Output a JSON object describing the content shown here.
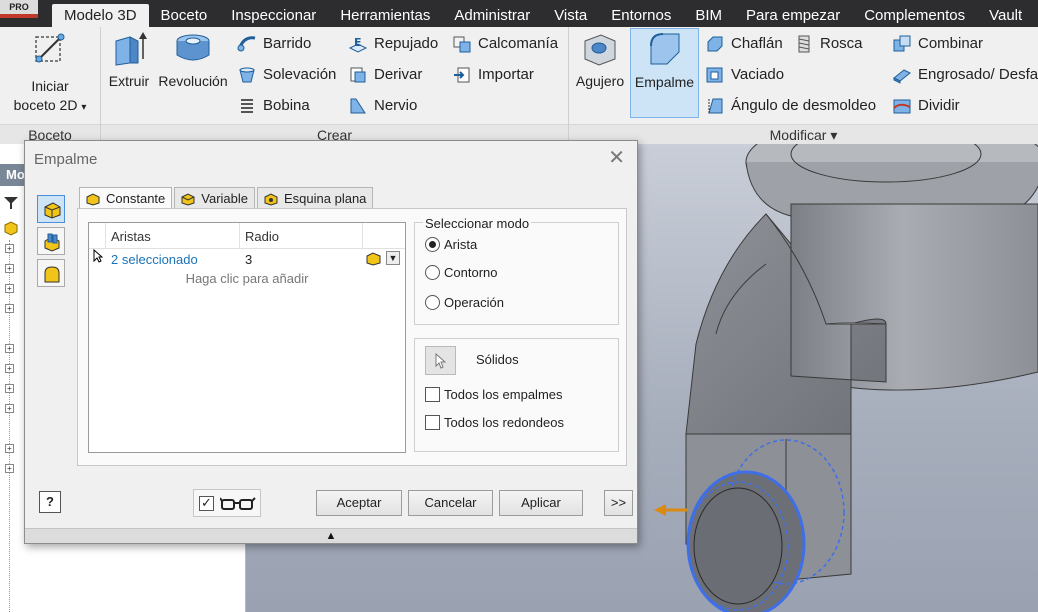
{
  "app": {
    "badge": "PRO"
  },
  "menu": {
    "tabs": [
      "Modelo 3D",
      "Boceto",
      "Inspeccionar",
      "Herramientas",
      "Administrar",
      "Vista",
      "Entornos",
      "BIM",
      "Para empezar",
      "Complementos",
      "Vault"
    ],
    "active_index": 0
  },
  "ribbon": {
    "boceto": {
      "label": "Boceto",
      "iniciar_line1": "Iniciar",
      "iniciar_line2": "boceto 2D",
      "dropdown": "▾"
    },
    "crear": {
      "label": "Crear",
      "extruir": "Extruir",
      "revolucion": "Revolución",
      "barrido": "Barrido",
      "solevacion": "Solevación",
      "bobina": "Bobina",
      "repujado": "Repujado",
      "derivar": "Derivar",
      "nervio": "Nervio",
      "calcomania": "Calcomanía",
      "importar": "Importar"
    },
    "modificar": {
      "label": "Modificar ▾",
      "agujero": "Agujero",
      "empalme": "Empalme",
      "chaflan": "Chaflán",
      "vaciado": "Vaciado",
      "angulo": "Ángulo de desmoldeo",
      "rosca": "Rosca",
      "combinar": "Combinar",
      "engrosado": "Engrosado/ Desfa",
      "dividir": "Dividir"
    }
  },
  "browser": {
    "header": "Mo"
  },
  "dialog": {
    "title": "Empalme",
    "close": "✕",
    "tabs": [
      "Constante",
      "Variable",
      "Esquina plana"
    ],
    "table": {
      "col_aristas": "Aristas",
      "col_radio": "Radio",
      "row_aristas": "2 seleccionado",
      "row_radio": "3",
      "hint": "Haga clic para añadir"
    },
    "select_mode": {
      "title": "Seleccionar modo",
      "options": [
        "Arista",
        "Contorno",
        "Operación"
      ],
      "selected_index": 0
    },
    "solids": {
      "label": "Sólidos",
      "all_fillets": "Todos los empalmes",
      "all_rounds": "Todos los redondeos"
    },
    "buttons": {
      "help": "?",
      "ok": "Aceptar",
      "cancel": "Cancelar",
      "apply": "Aplicar",
      "more": ">>"
    },
    "footer_arrow": "▲"
  },
  "colors": {
    "menubar": "#2d2d30",
    "accent_blue": "#1a73b8",
    "selection_highlight": "#cde4f7",
    "edge_highlight": "#3f6fe8",
    "direction_arrow": "#d98a12"
  }
}
